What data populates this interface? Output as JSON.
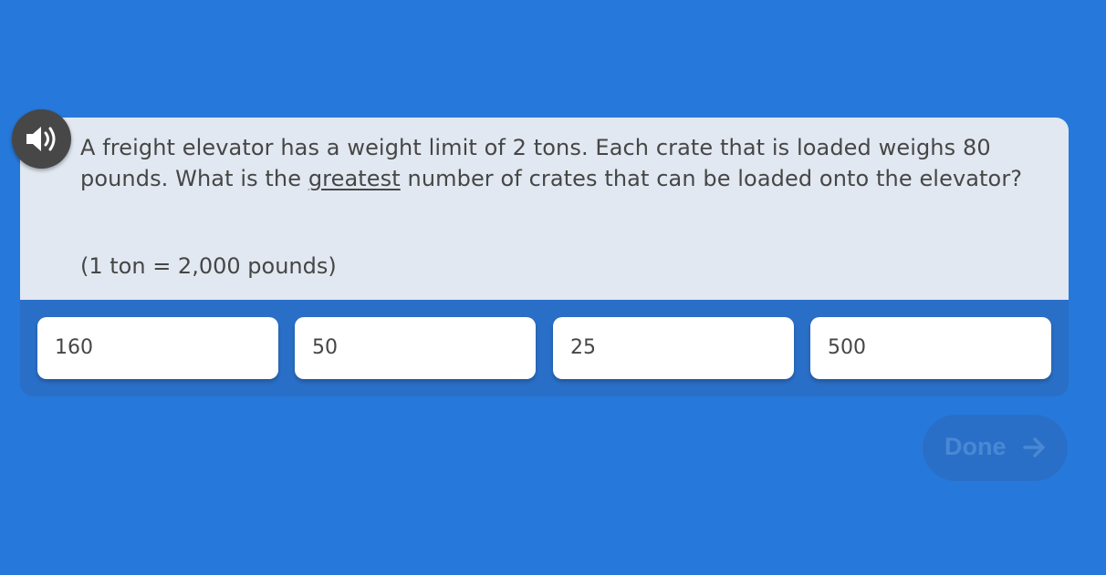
{
  "question": {
    "text_before": "A freight elevator has a weight limit of 2 tons. Each crate that is loaded weighs 80 pounds. What is the ",
    "emphasis": "greatest",
    "text_after": " number of crates that can be loaded onto the elevator?",
    "conversion": "(1 ton = 2,000 pounds)"
  },
  "answers": [
    {
      "label": "160"
    },
    {
      "label": "50"
    },
    {
      "label": "25"
    },
    {
      "label": "500"
    }
  ],
  "done_button": {
    "label": "Done",
    "icon": "arrow-right-icon"
  },
  "audio_button": {
    "icon": "speaker-icon"
  },
  "colors": {
    "background": "#2679db",
    "question_panel": "#e1e8f1",
    "answer_strip": "#2a6fc7",
    "text": "#464646",
    "done_disabled_text": "#4a88d4"
  }
}
